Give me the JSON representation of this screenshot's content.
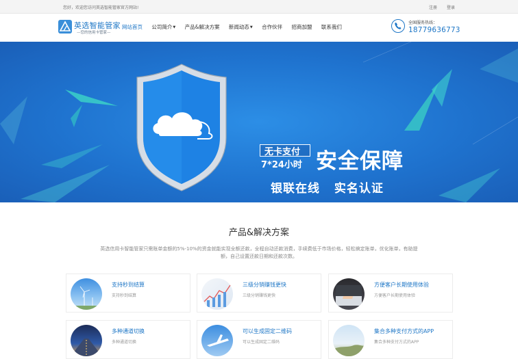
{
  "topbar": {
    "welcome": "您好，欢迎您访问英选智能管家官方网站!",
    "links": [
      "注册",
      "登录"
    ]
  },
  "header": {
    "logo_name": "英选智能管家",
    "logo_sub": "—您的信用卡管家—",
    "nav": [
      {
        "label": "网站首页",
        "active": true,
        "dropdown": false
      },
      {
        "label": "公司简介",
        "active": false,
        "dropdown": true
      },
      {
        "label": "产品&解决方案",
        "active": false,
        "dropdown": false
      },
      {
        "label": "新闻动态",
        "active": false,
        "dropdown": true
      },
      {
        "label": "合作伙伴",
        "active": false,
        "dropdown": false
      },
      {
        "label": "招商加盟",
        "active": false,
        "dropdown": false
      },
      {
        "label": "联系我们",
        "active": false,
        "dropdown": false
      }
    ],
    "hotline_label": "全国服务热线：",
    "hotline_number": "18779636773"
  },
  "banner": {
    "tag": "无卡支付",
    "hours": "7*24小时",
    "title": "安全保障",
    "subtitles": [
      "银联在线",
      "实名认证"
    ],
    "slides": 2,
    "active_slide": 0
  },
  "section": {
    "title": "产品&解决方案",
    "description": "英选信用卡智能管家只需账单金额的5%-10%的资金就能实现全额还款，全程自动还款消费，手续费低于市场价格，轻松搞定账单，优化账单，有助提额，自己设置还款日期和还款次数。"
  },
  "cards": [
    {
      "title": "支持秒到结算",
      "desc": "支持秒到结算",
      "thumb": "wind-turbine-sky"
    },
    {
      "title": "三级分销赚钱更快",
      "desc": "三级分销赚钱更快",
      "thumb": "chart-analysis"
    },
    {
      "title": "方便客户长期使用体验",
      "desc": "方便客户长期使用体验",
      "thumb": "hand-on-laptop"
    },
    {
      "title": "多种通道切换",
      "desc": "多种通道切换",
      "thumb": "road-tunnel"
    },
    {
      "title": "可以生成固定二维码",
      "desc": "可以生成固定二维码",
      "thumb": "airplane-sky"
    },
    {
      "title": "集合多种支付方式的APP",
      "desc": "集合多种支付方式的APP",
      "thumb": "sky-landscape"
    }
  ],
  "colors": {
    "brand": "#1d76c6",
    "banner": "#1f73cf",
    "teal": "#35c2c6"
  }
}
